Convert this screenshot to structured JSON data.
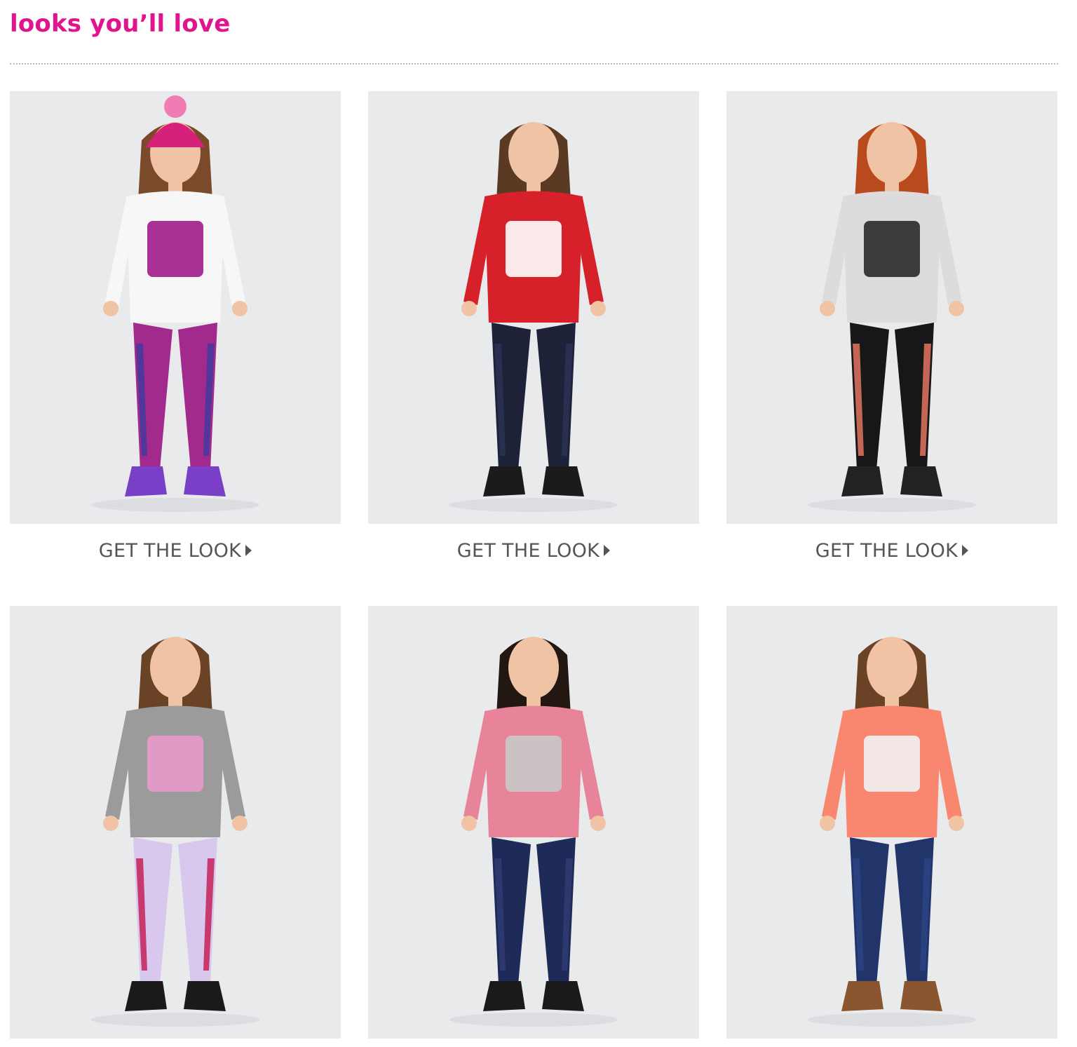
{
  "page": {
    "title": "looks you’ll love"
  },
  "looks": [
    {
      "cta_label": "GET THE LOOK",
      "colors": {
        "top": "#f7f7f7",
        "graphic": "#a0198a",
        "bottom": "#a12a8c",
        "bottomAccent": "#3d3aa0",
        "shoes": "#7a3fc7",
        "hat": "#d6207a",
        "hair": "#7a4a2a"
      }
    },
    {
      "cta_label": "GET THE LOOK",
      "colors": {
        "top": "#d6202a",
        "graphic": "#ffffff",
        "bottom": "#1d2238",
        "bottomAccent": "#2d3354",
        "shoes": "#1b1b1b",
        "hat": "",
        "hair": "#5a3a22"
      }
    },
    {
      "cta_label": "GET THE LOOK",
      "colors": {
        "top": "#dcdcdc",
        "graphic": "#2a2a2a",
        "bottom": "#171717",
        "bottomAccent": "#f07a66",
        "shoes": "#222222",
        "hat": "",
        "hair": "#b84a1e"
      }
    },
    {
      "cta_label": "",
      "colors": {
        "top": "#9b9b9b",
        "graphic": "#e89acb",
        "bottom": "#d8c8ee",
        "bottomAccent": "#c4154e",
        "shoes": "#1a1a1a",
        "hat": "",
        "hair": "#6a4226"
      }
    },
    {
      "cta_label": "",
      "colors": {
        "top": "#e8849a",
        "graphic": "#c9c9c9",
        "bottom": "#1e2a58",
        "bottomAccent": "#2f3c74",
        "shoes": "#1a1a1a",
        "hat": "",
        "hair": "#231811"
      }
    },
    {
      "cta_label": "",
      "colors": {
        "top": "#f98770",
        "graphic": "#f2f2f2",
        "bottom": "#22356a",
        "bottomAccent": "#2d4585",
        "shoes": "#8a5630",
        "hat": "",
        "hair": "#6a4226"
      }
    }
  ]
}
